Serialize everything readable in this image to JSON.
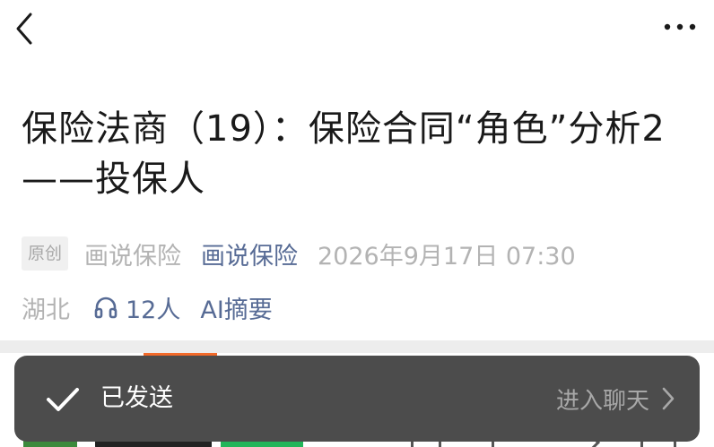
{
  "header": {
    "back_icon": "back-arrow-icon",
    "more_icon": "more-dots-icon"
  },
  "article": {
    "title": "保险法商（19）：保险合同“角色”分析2——投保人",
    "badge": "原创",
    "author_name": "画说保险",
    "account_name": "画说保险",
    "date": "2026年9月17日 07:30",
    "region": "湖北",
    "listeners": "12人",
    "ai_summary": "AI摘要"
  },
  "toast": {
    "message": "已发送",
    "action": "进入聊天",
    "icon": "check-icon"
  },
  "colors": {
    "link": "#576b95",
    "muted": "#b3b3b3",
    "toast_bg": "#4c4c4c",
    "accent_orange": "#f26a2a",
    "follow_green": "#23b55a"
  }
}
